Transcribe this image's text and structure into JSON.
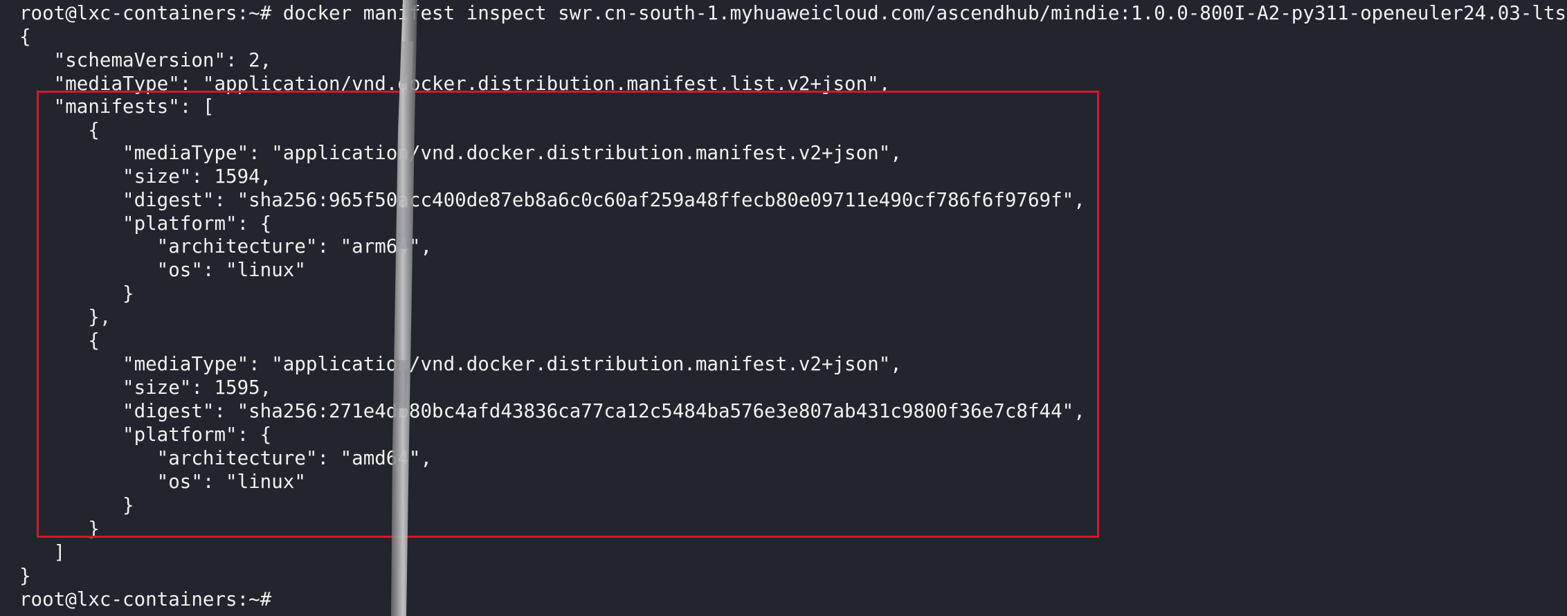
{
  "terminal": {
    "colors": {
      "background": "#22252d",
      "text": "#f1f1f1",
      "highlight_border": "#d8162c"
    },
    "lines": [
      "root@lxc-containers:~# docker manifest inspect swr.cn-south-1.myhuaweicloud.com/ascendhub/mindie:1.0.0-800I-A2-py311-openeuler24.03-lts",
      "{",
      "   \"schemaVersion\": 2,",
      "   \"mediaType\": \"application/vnd.docker.distribution.manifest.list.v2+json\",",
      "   \"manifests\": [",
      "      {",
      "         \"mediaType\": \"application/vnd.docker.distribution.manifest.v2+json\",",
      "         \"size\": 1594,",
      "         \"digest\": \"sha256:965f50acc400de87eb8a6c0c60af259a48ffecb80e09711e490cf786f6f9769f\",",
      "         \"platform\": {",
      "            \"architecture\": \"arm64\",",
      "            \"os\": \"linux\"",
      "         }",
      "      },",
      "      {",
      "         \"mediaType\": \"application/vnd.docker.distribution.manifest.v2+json\",",
      "         \"size\": 1595,",
      "         \"digest\": \"sha256:271e4db80bc4afd43836ca77ca12c5484ba576e3e807ab431c9800f36e7c8f44\",",
      "         \"platform\": {",
      "            \"architecture\": \"amd64\",",
      "            \"os\": \"linux\"",
      "         }",
      "      }",
      "   ]",
      "}",
      "root@lxc-containers:~#"
    ]
  }
}
